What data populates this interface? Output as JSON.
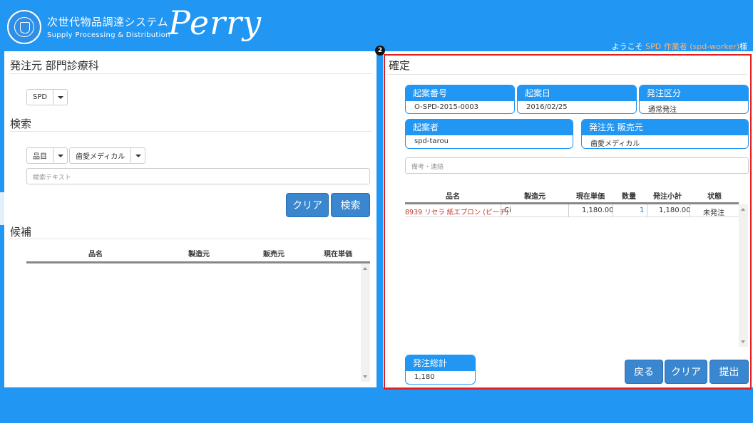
{
  "header": {
    "system_title": "次世代物品調達システム",
    "system_subtitle": "Supply Processing & Distribution",
    "brand": "Perry",
    "welcome_prefix": "ようこそ ",
    "welcome_user": "SPD 作業者 (spd-worker)",
    "welcome_suffix": "様"
  },
  "left": {
    "orderer_title": "発注元 部門診療科",
    "orderer_select": "SPD",
    "search_title": "検索",
    "search_field_select": "品目",
    "search_vendor_select": "歯愛メディカル",
    "search_placeholder": "検索テキスト",
    "clear_button": "クリア",
    "search_button": "検索",
    "candidates_title": "候補",
    "candidate_columns": [
      "品名",
      "製造元",
      "販売元",
      "現在単価"
    ]
  },
  "right": {
    "marker": "2",
    "confirm_title": "確定",
    "proposal_number_label": "起案番号",
    "proposal_number_value": "O-SPD-2015-0003",
    "proposal_date_label": "起案日",
    "proposal_date_value": "2016/02/25",
    "order_type_label": "発注区分",
    "order_type_value": "通常発注",
    "proposer_label": "起案者",
    "proposer_value": "spd-tarou",
    "supplier_label": "発注先 販売元",
    "supplier_value": "歯愛メディカル",
    "memo_placeholder": "備考・連絡",
    "order_columns": [
      "品名",
      "製造元",
      "現在単価",
      "数量",
      "発注小計",
      "状態"
    ],
    "order_rows": [
      {
        "name": "8939 リセラ 紙エプロン (ピーチ)",
        "maker": "Ci",
        "price": "1,180.00",
        "qty": "1",
        "subtotal": "1,180.00",
        "status": "未発注"
      }
    ],
    "total_label": "発注総計",
    "total_value": "1,180",
    "back_button": "戻る",
    "clear_button": "クリア",
    "submit_button": "提出"
  },
  "colors": {
    "primary": "#2196f3",
    "button": "#3a87d0",
    "highlight_border": "#e02020",
    "item_name": "#c0392b",
    "user_highlight": "#ffb36b"
  }
}
